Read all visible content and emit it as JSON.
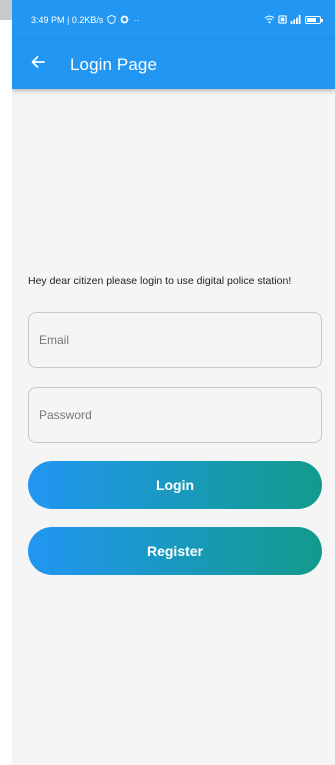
{
  "status_bar": {
    "time_and_speed": "3:49 PM | 0.2KB/s",
    "dots": "··"
  },
  "app_bar": {
    "title": "Login Page"
  },
  "intro_text": "Hey dear citizen please login to use digital police station!",
  "email": {
    "value": "",
    "placeholder": "Email"
  },
  "password": {
    "value": "",
    "placeholder": "Password"
  },
  "buttons": {
    "login_label": "Login",
    "register_label": "Register"
  },
  "colors": {
    "primary": "#2196f3",
    "gradient_end": "#129b8b",
    "background": "#f5f5f5"
  }
}
